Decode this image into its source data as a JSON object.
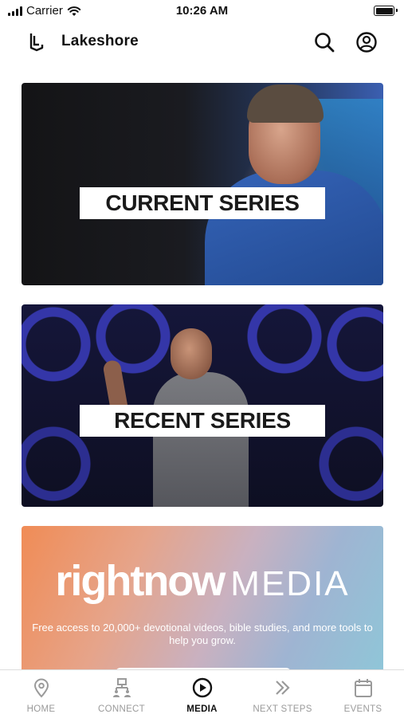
{
  "status_bar": {
    "carrier": "Carrier",
    "time": "10:26 AM"
  },
  "header": {
    "title": "Lakeshore",
    "icons": [
      "search-icon",
      "account-icon"
    ]
  },
  "cards": [
    {
      "label": "CURRENT SERIES"
    },
    {
      "label": "RECENT SERIES"
    },
    {
      "brand_part1": "rightnow",
      "brand_part2": "MEDIA",
      "tagline": "Free access to 20,000+ devotional videos, bible studies, and more tools to help you grow."
    }
  ],
  "tabbar": {
    "active": "MEDIA",
    "tabs": [
      {
        "label": "HOME",
        "icon": "location-pin-icon"
      },
      {
        "label": "CONNECT",
        "icon": "people-network-icon"
      },
      {
        "label": "MEDIA",
        "icon": "play-circle-icon"
      },
      {
        "label": "NEXT STEPS",
        "icon": "double-chevron-icon"
      },
      {
        "label": "EVENTS",
        "icon": "calendar-icon"
      }
    ]
  },
  "colors": {
    "accent": "#111111",
    "inactive_tab": "#9a9a9a"
  }
}
